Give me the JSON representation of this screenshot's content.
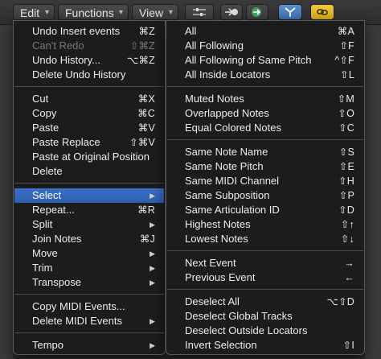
{
  "toolbar": {
    "edit": "Edit",
    "functions": "Functions",
    "view": "View",
    "icons": [
      "sliders-icon",
      "midi-in-icon",
      "midi-out-icon",
      "catch-icon",
      "link-icon"
    ]
  },
  "edit_menu": [
    {
      "label": "Undo Insert events",
      "shortcut": "⌘Z"
    },
    {
      "label": "Can't Redo",
      "shortcut": "⇧⌘Z",
      "disabled": true
    },
    {
      "label": "Undo History...",
      "shortcut": "⌥⌘Z"
    },
    {
      "label": "Delete Undo History",
      "shortcut": ""
    },
    {
      "label": "Cut",
      "shortcut": "⌘X"
    },
    {
      "label": "Copy",
      "shortcut": "⌘C"
    },
    {
      "label": "Paste",
      "shortcut": "⌘V"
    },
    {
      "label": "Paste Replace",
      "shortcut": "⇧⌘V"
    },
    {
      "label": "Paste at Original Position",
      "shortcut": ""
    },
    {
      "label": "Delete",
      "shortcut": ""
    },
    {
      "label": "Select",
      "submenu": true,
      "highlighted": true
    },
    {
      "label": "Repeat...",
      "shortcut": "⌘R"
    },
    {
      "label": "Split",
      "submenu": true
    },
    {
      "label": "Join Notes",
      "shortcut": "⌘J"
    },
    {
      "label": "Move",
      "submenu": true
    },
    {
      "label": "Trim",
      "submenu": true
    },
    {
      "label": "Transpose",
      "submenu": true
    },
    {
      "label": "Copy MIDI Events...",
      "shortcut": ""
    },
    {
      "label": "Delete MIDI Events",
      "submenu": true
    },
    {
      "label": "Tempo",
      "submenu": true
    }
  ],
  "select_menu": [
    {
      "label": "All",
      "shortcut": "⌘A"
    },
    {
      "label": "All Following",
      "shortcut": "⇧F"
    },
    {
      "label": "All Following of Same Pitch",
      "shortcut": "^⇧F"
    },
    {
      "label": "All Inside Locators",
      "shortcut": "⇧L"
    },
    {
      "label": "Muted Notes",
      "shortcut": "⇧M"
    },
    {
      "label": "Overlapped Notes",
      "shortcut": "⇧O"
    },
    {
      "label": "Equal Colored Notes",
      "shortcut": "⇧C"
    },
    {
      "label": "Same Note Name",
      "shortcut": "⇧S"
    },
    {
      "label": "Same Note Pitch",
      "shortcut": "⇧E"
    },
    {
      "label": "Same MIDI Channel",
      "shortcut": "⇧H"
    },
    {
      "label": "Same Subposition",
      "shortcut": "⇧P"
    },
    {
      "label": "Same Articulation ID",
      "shortcut": "⇧D"
    },
    {
      "label": "Highest Notes",
      "shortcut": "⇧↑"
    },
    {
      "label": "Lowest Notes",
      "shortcut": "⇧↓"
    },
    {
      "label": "Next Event",
      "shortcut": "→"
    },
    {
      "label": "Previous Event",
      "shortcut": "←"
    },
    {
      "label": "Deselect All",
      "shortcut": "⌥⇧D"
    },
    {
      "label": "Deselect Global Tracks",
      "shortcut": ""
    },
    {
      "label": "Deselect Outside Locators",
      "shortcut": ""
    },
    {
      "label": "Invert Selection",
      "shortcut": "⇧I"
    }
  ],
  "colors": {
    "highlight": "#3b6fc4",
    "midi_out_green": "#3aa35a",
    "catch_blue": "#5d8fd0",
    "link_yellow": "#f0c93b"
  }
}
